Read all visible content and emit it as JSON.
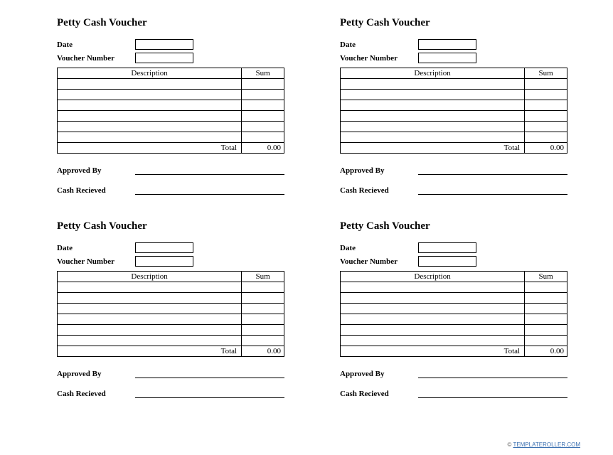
{
  "voucher": {
    "title": "Petty Cash Voucher",
    "date_label": "Date",
    "number_label": "Voucher Number",
    "col_description": "Description",
    "col_sum": "Sum",
    "total_label": "Total",
    "total_value": "0.00",
    "approved_label": "Approved By",
    "received_label": "Cash Recieved"
  },
  "footer": {
    "copyright": "©",
    "site": "TEMPLATEROLLER.COM"
  }
}
